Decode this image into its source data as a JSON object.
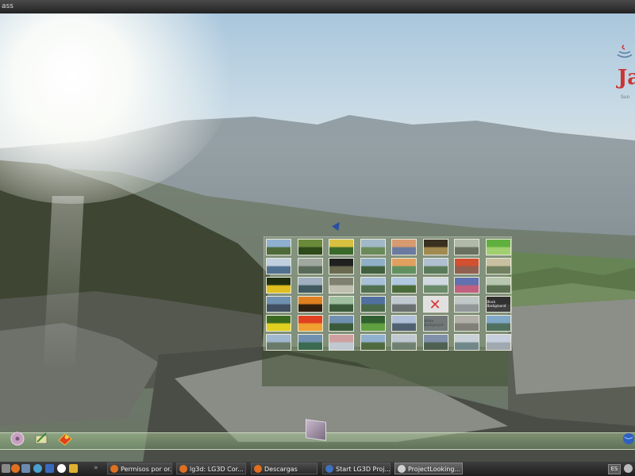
{
  "window": {
    "title": "ass"
  },
  "java_logo": {
    "word": "Ja",
    "sub": "Sun"
  },
  "thumbnails": [
    {
      "c1": "#8fb0d0",
      "c2": "#4e6a3a"
    },
    {
      "c1": "#6a8a3a",
      "c2": "#2e4a1a"
    },
    {
      "c1": "#d8c040",
      "c2": "#3a6a2a"
    },
    {
      "c1": "#a0b8c8",
      "c2": "#6a8a5a"
    },
    {
      "c1": "#d89a70",
      "c2": "#6a7aa0"
    },
    {
      "c1": "#3a3020",
      "c2": "#a08a50"
    },
    {
      "c1": "#b0b8a8",
      "c2": "#6a7060"
    },
    {
      "c1": "#60b040",
      "c2": "#a0d070"
    },
    {
      "c1": "#c0d0e0",
      "c2": "#507090"
    },
    {
      "c1": "#a0a8a0",
      "c2": "#5a6a5a"
    },
    {
      "c1": "#202020",
      "c2": "#6a6a50"
    },
    {
      "c1": "#90b0c8",
      "c2": "#406040"
    },
    {
      "c1": "#e0a060",
      "c2": "#609060"
    },
    {
      "c1": "#b0c0d0",
      "c2": "#5a7a5a"
    },
    {
      "c1": "#d05030",
      "c2": "#906050"
    },
    {
      "c1": "#c8c0a0",
      "c2": "#708060"
    },
    {
      "c1": "#203010",
      "c2": "#e0c020"
    },
    {
      "c1": "#a0b0c0",
      "c2": "#405a60"
    },
    {
      "c1": "#808070",
      "c2": "#c0c0b0"
    },
    {
      "c1": "#a8c0d8",
      "c2": "#507050"
    },
    {
      "c1": "#b0c8e0",
      "c2": "#4a6a3a"
    },
    {
      "c1": "#d0d8e0",
      "c2": "#6a8a6a"
    },
    {
      "c1": "#6070b0",
      "c2": "#c06080"
    },
    {
      "c1": "#b8c8b0",
      "c2": "#5a7050"
    },
    {
      "c1": "#7090b0",
      "c2": "#405060"
    },
    {
      "c1": "#e08020",
      "c2": "#302010"
    },
    {
      "c1": "#a0c0a0",
      "c2": "#3a5a3a"
    },
    {
      "c1": "#5070a0",
      "c2": "#4a6a4a"
    },
    {
      "c1": "#c0c8d0",
      "c2": "#6a7070"
    },
    {
      "c1": "#e0e0e0",
      "c2": "#e0e0e0"
    },
    {
      "c1": "#c0c8c8",
      "c2": "#909898"
    },
    {
      "c1": "#303030",
      "c2": "#404040"
    },
    {
      "c1": "#3a6a20",
      "c2": "#e0d020"
    },
    {
      "c1": "#e04020",
      "c2": "#f0a030"
    },
    {
      "c1": "#7090b0",
      "c2": "#3a5a3a"
    },
    {
      "c1": "#306030",
      "c2": "#60a040"
    },
    {
      "c1": "#b0c0d8",
      "c2": "#506070"
    },
    {
      "c1": "#707878",
      "c2": "#707878"
    },
    {
      "c1": "#b0b0a8",
      "c2": "#808078"
    },
    {
      "c1": "#80a8c8",
      "c2": "#507060"
    },
    {
      "c1": "#a0b8d0",
      "c2": "#6a7a6a"
    },
    {
      "c1": "#7090b0",
      "c2": "#3a6a50"
    },
    {
      "c1": "#d0a0a0",
      "c2": "#c0c8d0"
    },
    {
      "c1": "#90b0d0",
      "c2": "#506a40"
    },
    {
      "c1": "#c0c8d0",
      "c2": "#708070"
    },
    {
      "c1": "#8090a8",
      "c2": "#506050"
    },
    {
      "c1": "#c8d0d8",
      "c2": "#70888a"
    },
    {
      "c1": "#c8d0e0",
      "c2": "#a0a8b0"
    }
  ],
  "thumb_labels": {
    "white_bg": "White Background",
    "black_bg": "Black Background"
  },
  "taskbar": {
    "separator": "»",
    "tasks": [
      {
        "label": "Permisos por or...",
        "icon": "firefox-icon",
        "color": "#e07020",
        "active": false
      },
      {
        "label": "lg3d: LG3D Cor...",
        "icon": "firefox-icon",
        "color": "#e07020",
        "active": false
      },
      {
        "label": "Descargas",
        "icon": "firefox-icon",
        "color": "#e07020",
        "active": false
      },
      {
        "label": "Start LG3D Proj...",
        "icon": "terminal-icon",
        "color": "#4070c0",
        "active": false
      },
      {
        "label": "ProjectLooking...",
        "icon": "document-icon",
        "color": "#d0d0d0",
        "active": true
      }
    ],
    "lang": "ES"
  }
}
